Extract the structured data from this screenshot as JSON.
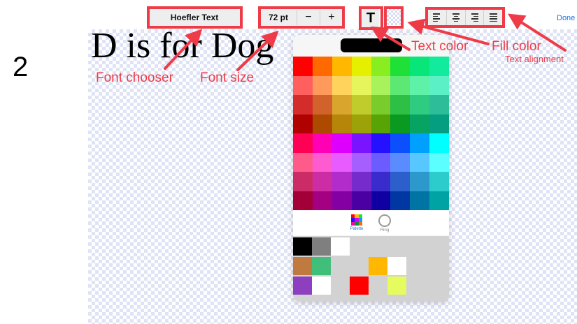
{
  "step_number": "2",
  "document_text": "D is for Dog",
  "toolbar": {
    "font_name": "Hoefler Text",
    "font_size_value": "72 pt",
    "decrease_label": "−",
    "increase_label": "+",
    "text_color_glyph": "T",
    "done_label": "Done"
  },
  "annotations": {
    "font_chooser": "Font chooser",
    "font_size": "Font size",
    "text_color": "Text color",
    "fill_color": "Fill color",
    "text_alignment": "Text alignment",
    "color": "#ee3b47"
  },
  "color_picker": {
    "tabs": [
      {
        "label": "Palette",
        "icon": "palette-grid-icon",
        "selected": true
      },
      {
        "label": "Ring",
        "icon": "ring-icon",
        "selected": false
      }
    ],
    "palette_rows": [
      [
        "#ff0000",
        "#ff6a00",
        "#ffb700",
        "#e5f000",
        "#88ee1f",
        "#1fe036",
        "#08e67a",
        "#12ea9d"
      ],
      [
        "#ff5f5f",
        "#ff9a5c",
        "#ffd35c",
        "#e5f55b",
        "#a8f25c",
        "#5ce872",
        "#5ef2a8",
        "#5cf0c6"
      ],
      [
        "#d42b2b",
        "#d1622b",
        "#d9a52c",
        "#bfcc2c",
        "#7acc2c",
        "#2ebf45",
        "#2fcb80",
        "#2dbd99"
      ],
      [
        "#b00000",
        "#ad4a00",
        "#b5860a",
        "#9ba308",
        "#58a306",
        "#0a9a22",
        "#06a363",
        "#059e80"
      ],
      [
        "#ff0055",
        "#ff00b5",
        "#dd00ff",
        "#7a13ff",
        "#2510ff",
        "#0b4fff",
        "#00a0ff",
        "#00ffff"
      ],
      [
        "#ff5b8a",
        "#ff5bd0",
        "#e85bff",
        "#a75eff",
        "#6c5bff",
        "#5b8cff",
        "#58c6ff",
        "#5bffff"
      ],
      [
        "#cc2c66",
        "#cc2ca4",
        "#b22ccc",
        "#762ccc",
        "#3a2ccc",
        "#2c5fcc",
        "#2c98cc",
        "#2ccccc"
      ],
      [
        "#a30037",
        "#a30082",
        "#8400a3",
        "#4a00a3",
        "#1000a3",
        "#0037a3",
        "#0075a3",
        "#00a3a3"
      ]
    ],
    "recent_colors": [
      [
        "#000000",
        "#7f7f7f",
        "#ffffff"
      ],
      [
        "#c07a3f",
        "#3fbf7a",
        "#ffb700",
        "#ffffff"
      ],
      [
        "#8e3fbf",
        "#ffffff",
        "#ff0000",
        "#e6fb5e"
      ]
    ]
  }
}
